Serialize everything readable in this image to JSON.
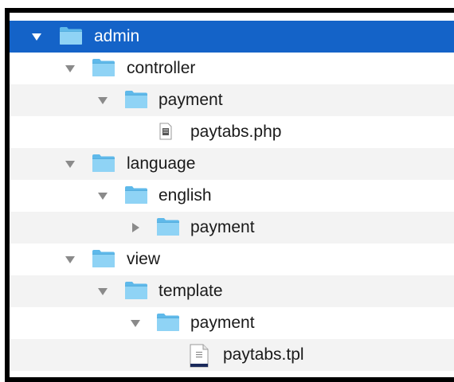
{
  "tree": {
    "rows": [
      {
        "label": "admin",
        "icon": "folder-icon",
        "expanded": true,
        "selected": true
      },
      {
        "label": "controller",
        "icon": "folder-icon",
        "expanded": true
      },
      {
        "label": "payment",
        "icon": "folder-icon",
        "expanded": true
      },
      {
        "label": "paytabs.php",
        "icon": "php-file-icon"
      },
      {
        "label": "language",
        "icon": "folder-icon",
        "expanded": true
      },
      {
        "label": "english",
        "icon": "folder-icon",
        "expanded": true
      },
      {
        "label": "payment",
        "icon": "folder-icon",
        "expanded": false
      },
      {
        "label": "view",
        "icon": "folder-icon",
        "expanded": true
      },
      {
        "label": "template",
        "icon": "folder-icon",
        "expanded": true
      },
      {
        "label": "payment",
        "icon": "folder-icon",
        "expanded": true
      },
      {
        "label": "paytabs.tpl",
        "icon": "tpl-file-icon"
      }
    ]
  },
  "colors": {
    "selection": "#1463c8",
    "folder": "#6cc4f0",
    "alt_row": "#f3f3f3"
  }
}
